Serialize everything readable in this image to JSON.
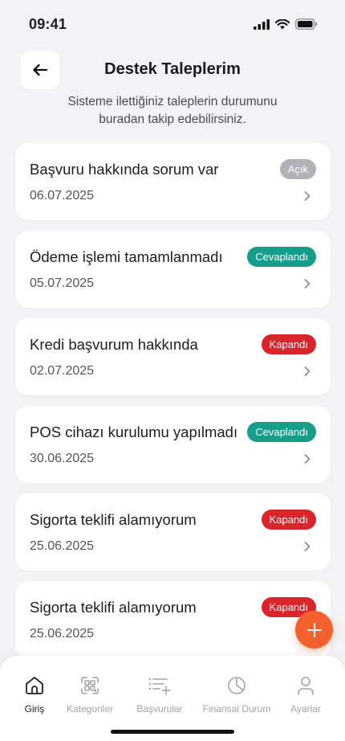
{
  "status_bar": {
    "time": "09:41"
  },
  "header": {
    "title": "Destek Taleplerim",
    "subtitle": "Sisteme ilettiğiniz taleplerin durumunu buradan takip edebilirsiniz."
  },
  "status_colors": {
    "Açık": "#b1b1b6",
    "Cevaplandı": "#169e8b",
    "Kapandı": "#d8262c"
  },
  "accent_color": "#f4612e",
  "tickets": [
    {
      "title": "Başvuru hakkında sorum var",
      "date": "06.07.2025",
      "status": "Açık"
    },
    {
      "title": "Ödeme işlemi tamamlanmadı",
      "date": "05.07.2025",
      "status": "Cevaplandı"
    },
    {
      "title": "Kredi başvurum hakkında",
      "date": "02.07.2025",
      "status": "Kapandı"
    },
    {
      "title": "POS cihazı kurulumu yapılmadı",
      "date": "30.06.2025",
      "status": "Cevaplandı"
    },
    {
      "title": "Sigorta teklifi alamıyorum",
      "date": "25.06.2025",
      "status": "Kapandı"
    },
    {
      "title": "Sigorta teklifi alamıyorum",
      "date": "25.06.2025",
      "status": "Kapandı"
    }
  ],
  "bottom_nav": {
    "items": [
      {
        "label": "Giriş",
        "icon": "home-icon",
        "active": true
      },
      {
        "label": "Kategoriler",
        "icon": "categories-icon",
        "active": false
      },
      {
        "label": "Başvurular",
        "icon": "applications-icon",
        "active": false
      },
      {
        "label": "Finansal Durum",
        "icon": "pie-chart-icon",
        "active": false
      },
      {
        "label": "Ayarlar",
        "icon": "user-icon",
        "active": false
      }
    ]
  }
}
